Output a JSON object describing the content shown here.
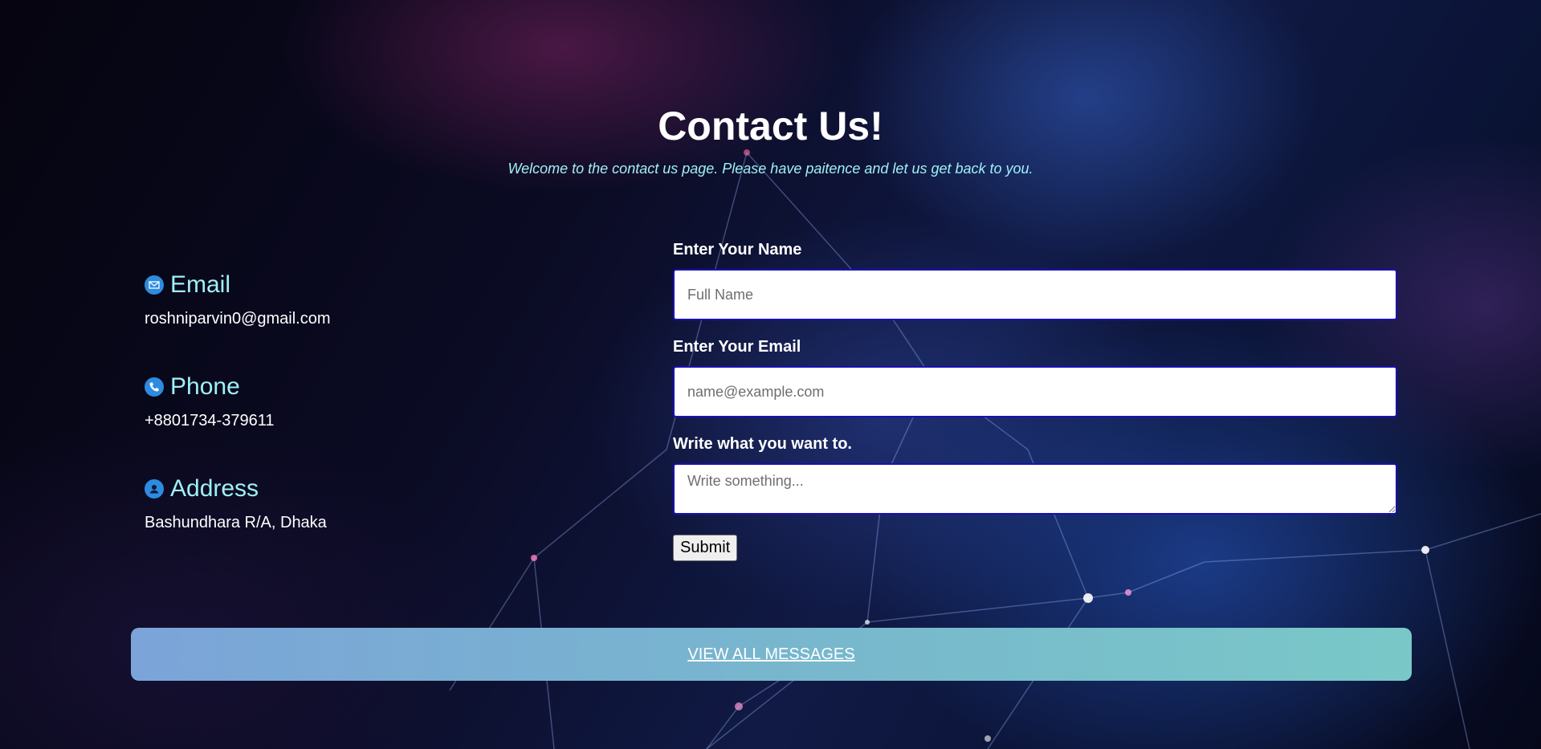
{
  "header": {
    "title": "Contact Us!",
    "subtitle": "Welcome to the contact us page. Please have paitence and let us get back to you."
  },
  "contact_info": {
    "email": {
      "icon": "envelope-icon",
      "title": "Email",
      "value": "roshniparvin0@gmail.com"
    },
    "phone": {
      "icon": "phone-icon",
      "title": "Phone",
      "value": "+8801734-379611"
    },
    "address": {
      "icon": "person-icon",
      "title": "Address",
      "value": "Bashundhara R/A, Dhaka"
    }
  },
  "form": {
    "name_label": "Enter Your Name",
    "name_placeholder": "Full Name",
    "email_label": "Enter Your Email",
    "email_placeholder": "name@example.com",
    "message_label": "Write what you want to.",
    "message_placeholder": "Write something...",
    "submit_label": "Submit"
  },
  "footer": {
    "messages_link": "VIEW ALL MESSAGES"
  },
  "colors": {
    "accent_text": "#9ff0f6",
    "input_border": "#1a10b8",
    "bar_gradient_start": "#7ba4d8",
    "bar_gradient_end": "#79c8c7"
  }
}
